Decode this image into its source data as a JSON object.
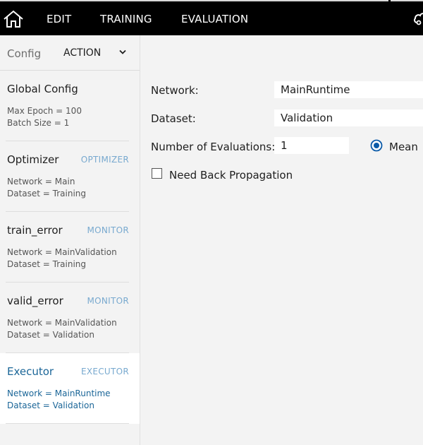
{
  "topbar": {
    "menu": [
      {
        "label": "EDIT"
      },
      {
        "label": "TRAINING"
      },
      {
        "label": "EVALUATION"
      }
    ]
  },
  "sidebar": {
    "config_label": "Config",
    "dropdown_value": "ACTION",
    "cards": [
      {
        "title": "Global Config",
        "type": "",
        "line1": "Max Epoch = 100",
        "line2": "Batch Size = 1"
      },
      {
        "title": "Optimizer",
        "type": "OPTIMIZER",
        "line1": "Network = Main",
        "line2": "Dataset = Training"
      },
      {
        "title": "train_error",
        "type": "MONITOR",
        "line1": "Network = MainValidation",
        "line2": "Dataset = Training"
      },
      {
        "title": "valid_error",
        "type": "MONITOR",
        "line1": "Network = MainValidation",
        "line2": "Dataset = Validation"
      },
      {
        "title": "Executor",
        "type": "EXECUTOR",
        "line1": "Network = MainRuntime",
        "line2": "Dataset = Validation"
      }
    ]
  },
  "main": {
    "network_label": "Network:",
    "network_value": "MainRuntime",
    "dataset_label": "Dataset:",
    "dataset_value": "Validation",
    "evaluations_label": "Number of Evaluations:",
    "evaluations_value": "1",
    "mean_label": "Mean",
    "backprop_label": "Need Back Propagation"
  },
  "colors": {
    "accent": "#1b6698",
    "type_tag": "#78a9cf",
    "radio": "#0a5aa8"
  }
}
